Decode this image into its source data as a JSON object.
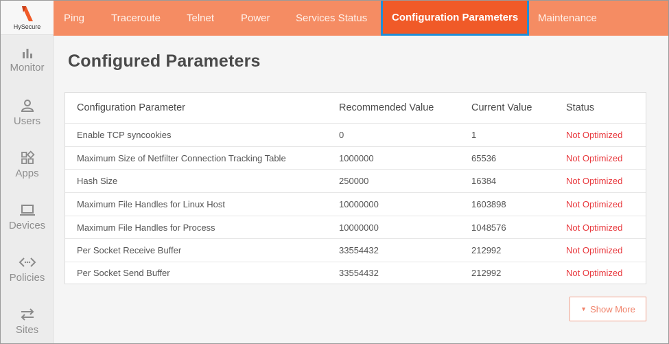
{
  "logo": {
    "text": "HySecure"
  },
  "sidebar": {
    "items": [
      {
        "label": "Monitor",
        "icon": "bar-chart-icon"
      },
      {
        "label": "Users",
        "icon": "user-icon"
      },
      {
        "label": "Apps",
        "icon": "apps-icon"
      },
      {
        "label": "Devices",
        "icon": "laptop-icon"
      },
      {
        "label": "Policies",
        "icon": "code-icon"
      },
      {
        "label": "Sites",
        "icon": "swap-arrows-icon"
      }
    ]
  },
  "tabs": [
    {
      "label": "Ping"
    },
    {
      "label": "Traceroute"
    },
    {
      "label": "Telnet"
    },
    {
      "label": "Power"
    },
    {
      "label": "Services Status"
    },
    {
      "label": "Configuration Parameters",
      "active": true
    },
    {
      "label": "Maintenance"
    }
  ],
  "page": {
    "title": "Configured Parameters"
  },
  "table": {
    "headers": [
      "Configuration Parameter",
      "Recommended Value",
      "Current Value",
      "Status"
    ],
    "rows": [
      [
        "Enable TCP syncookies",
        "0",
        "1",
        "Not Optimized"
      ],
      [
        "Maximum Size of Netfilter Connection Tracking Table",
        "1000000",
        "65536",
        "Not Optimized"
      ],
      [
        "Hash Size",
        "250000",
        "16384",
        "Not Optimized"
      ],
      [
        "Maximum File Handles for Linux Host",
        "10000000",
        "1603898",
        "Not Optimized"
      ],
      [
        "Maximum File Handles for Process",
        "10000000",
        "1048576",
        "Not Optimized"
      ],
      [
        "Per Socket Receive Buffer",
        "33554432",
        "212992",
        "Not Optimized"
      ],
      [
        "Per Socket Send Buffer",
        "33554432",
        "212992",
        "Not Optimized"
      ]
    ]
  },
  "show_more": {
    "label": "Show More"
  },
  "colors": {
    "nav": "#f58c63",
    "active_tab": "#f05a28",
    "active_border": "#1f8fd8",
    "status_bad": "#e8383d"
  }
}
